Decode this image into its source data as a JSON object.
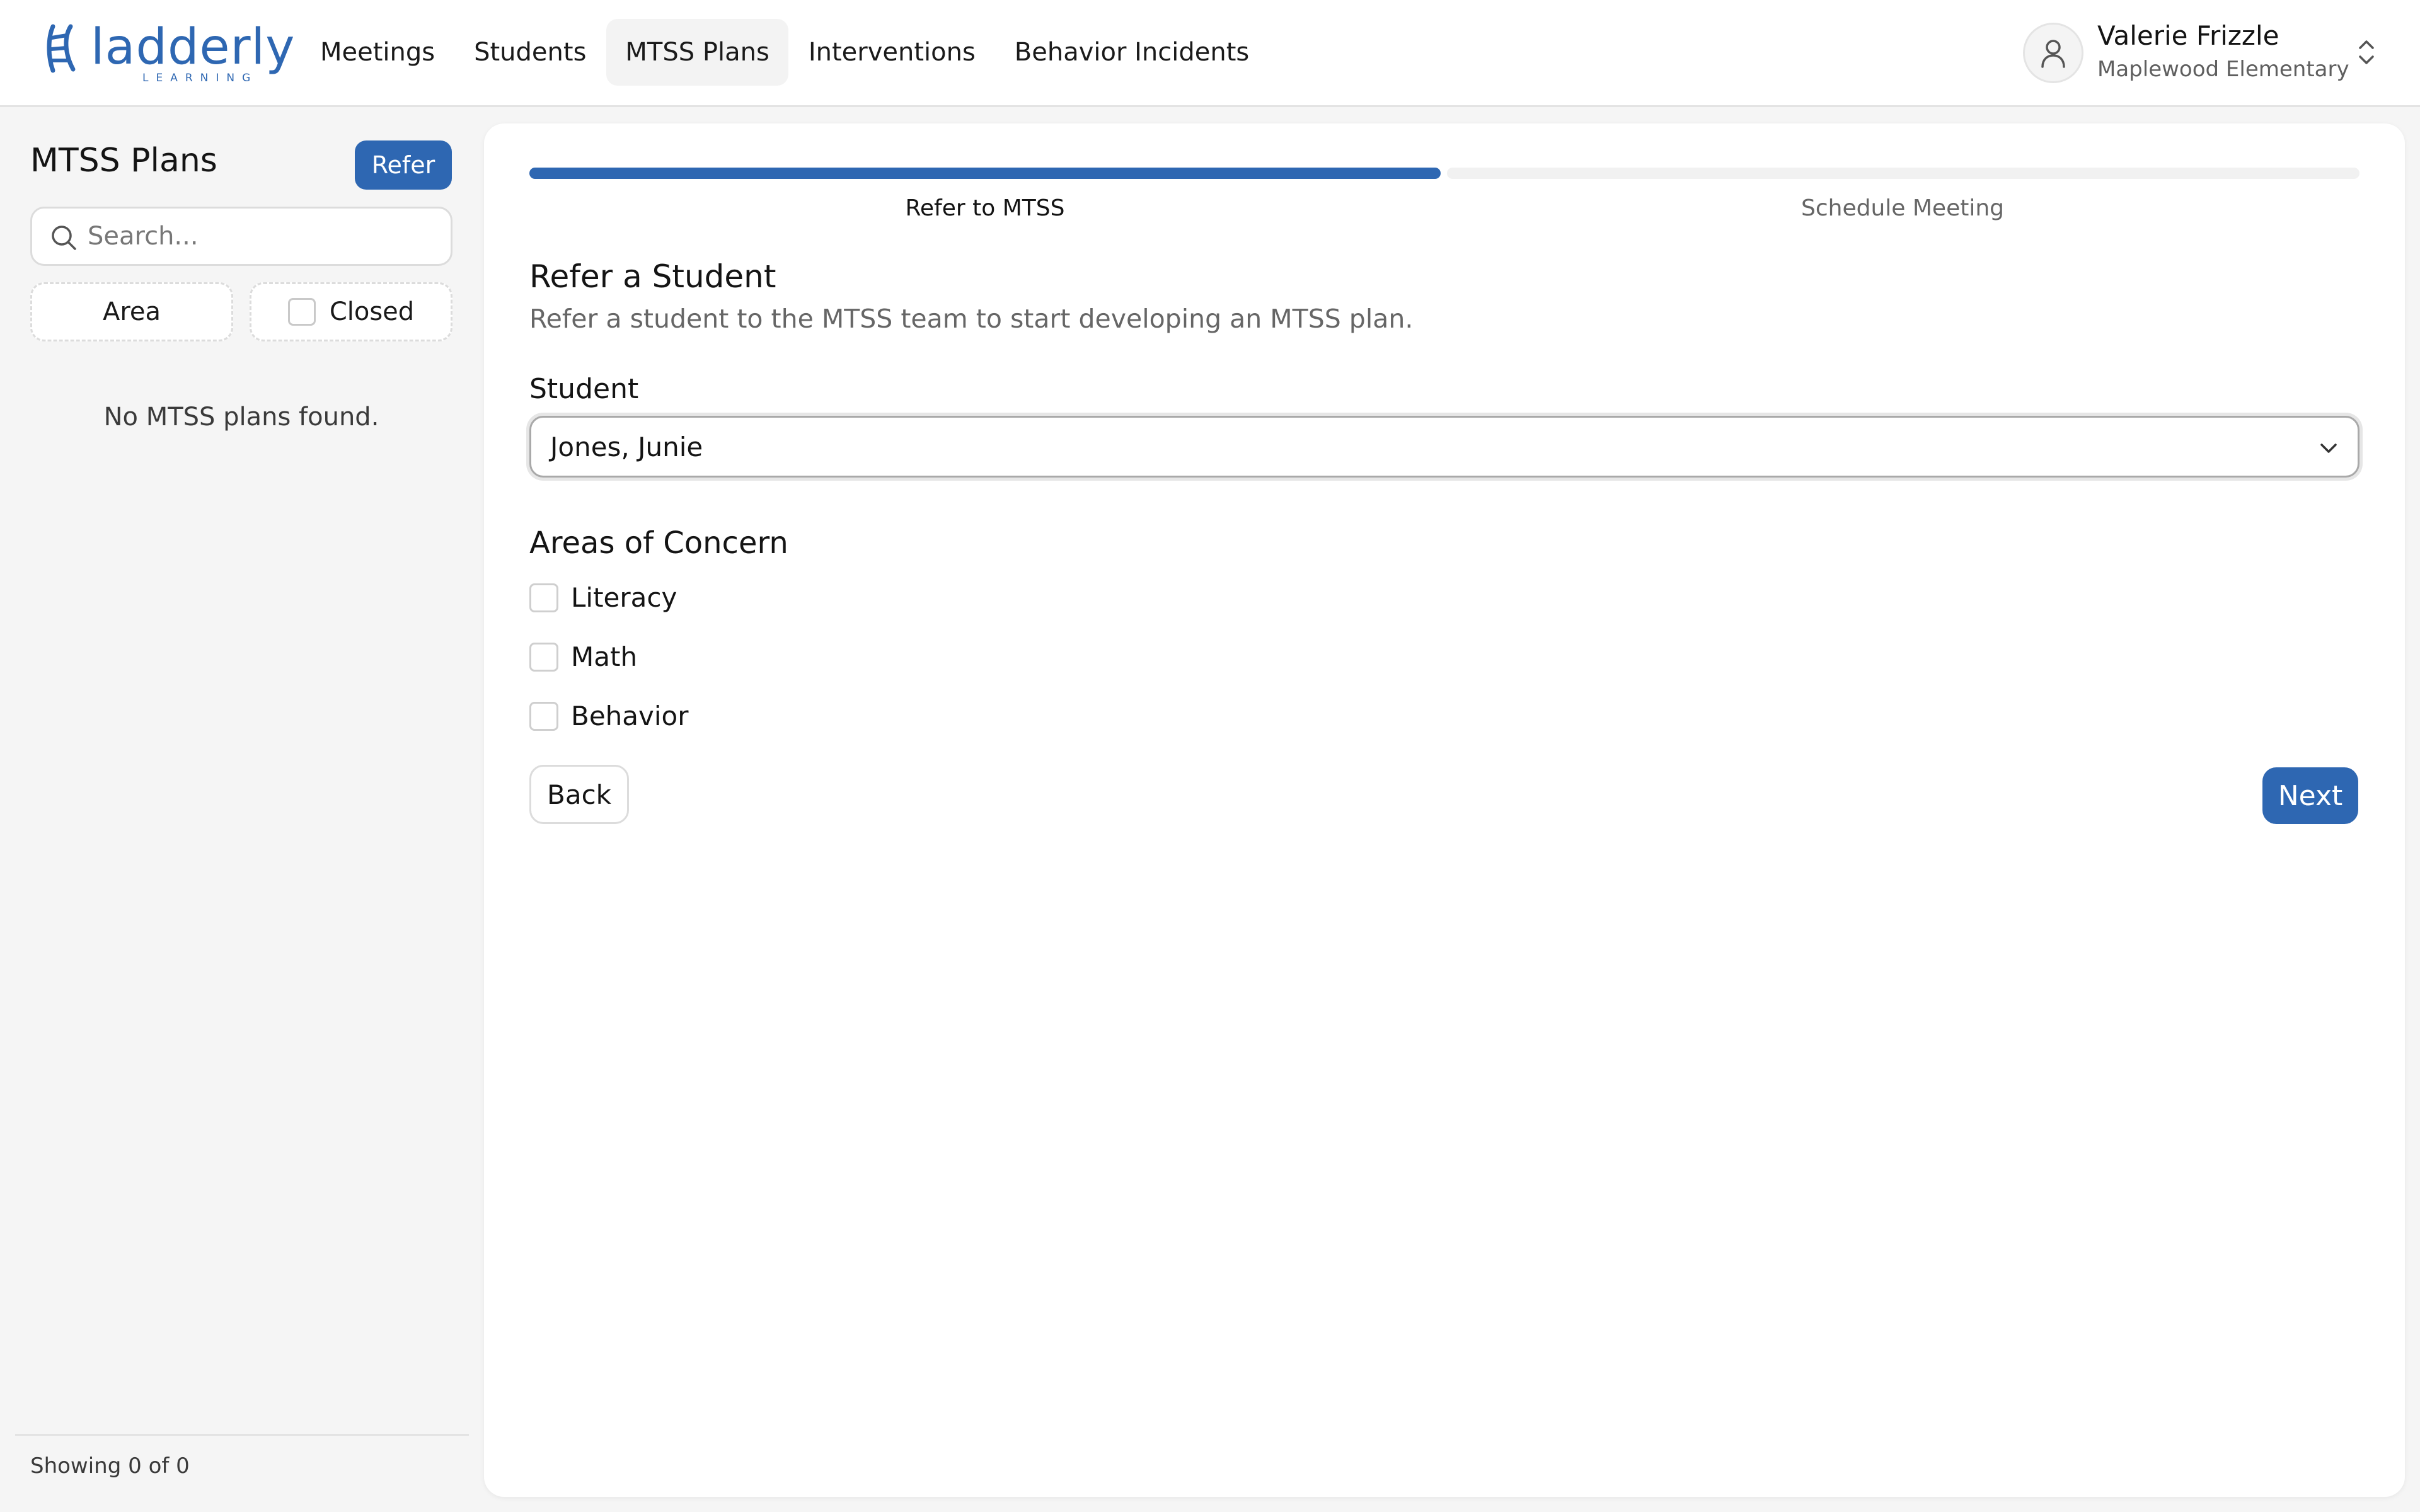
{
  "brand": {
    "name": "ladderly",
    "subtitle": "LEARNING",
    "color": "#2e67b2"
  },
  "nav": {
    "items": [
      {
        "label": "Meetings"
      },
      {
        "label": "Students"
      },
      {
        "label": "MTSS Plans",
        "active": true
      },
      {
        "label": "Interventions"
      },
      {
        "label": "Behavior Incidents"
      }
    ]
  },
  "user": {
    "name": "Valerie Frizzle",
    "school": "Maplewood Elementary",
    "avatar_icon": "user-icon",
    "switch_icon": "chevron-up-down-icon"
  },
  "sidebar": {
    "title": "MTSS Plans",
    "refer_label": "Refer",
    "search": {
      "placeholder": "Search...",
      "value": "",
      "icon": "search-icon"
    },
    "filters": {
      "area_label": "Area",
      "closed_label": "Closed",
      "closed_checked": false
    },
    "empty_message": "No MTSS plans found.",
    "footer": "Showing 0 of 0"
  },
  "wizard": {
    "progress": {
      "current_step": 1,
      "total_steps": 2
    },
    "steps": [
      {
        "label": "Refer to MTSS"
      },
      {
        "label": "Schedule Meeting"
      }
    ],
    "title": "Refer a Student",
    "description": "Refer a student to the MTSS team to start developing an MTSS plan.",
    "student_label": "Student",
    "student_value": "Jones, Junie",
    "concerns_title": "Areas of Concern",
    "concerns": [
      {
        "label": "Literacy",
        "checked": false
      },
      {
        "label": "Math",
        "checked": false
      },
      {
        "label": "Behavior",
        "checked": false
      }
    ],
    "back_label": "Back",
    "next_label": "Next"
  }
}
